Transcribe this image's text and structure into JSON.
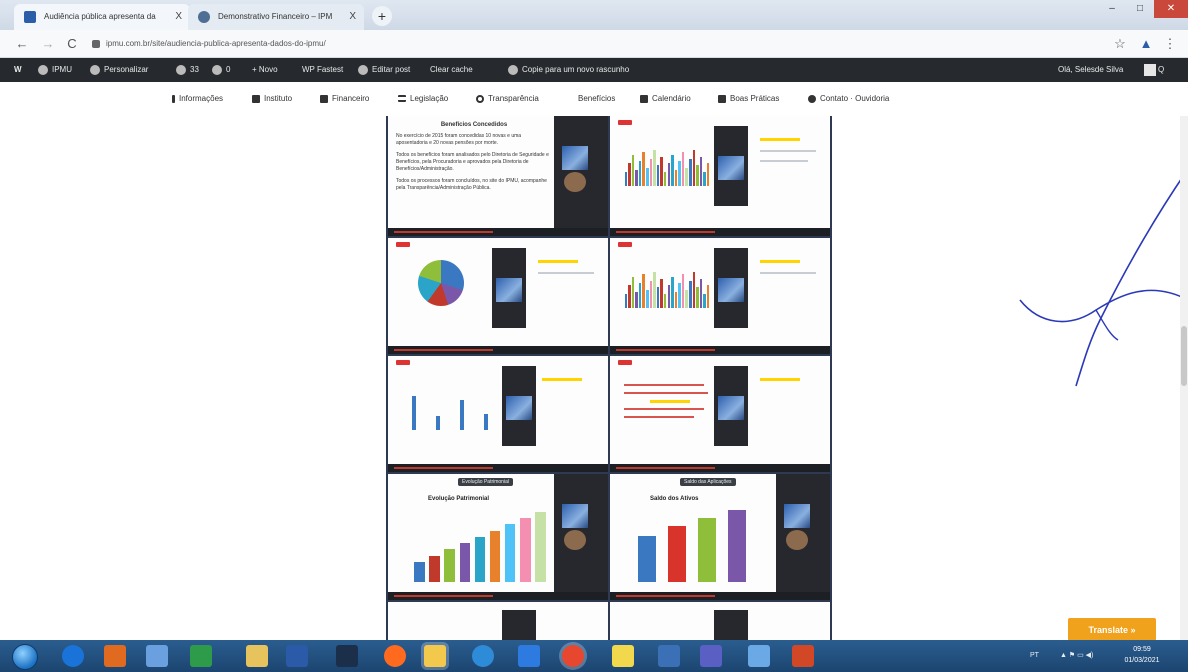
{
  "browser": {
    "tabs": [
      {
        "label": "Audiência pública apresenta da",
        "close": "X"
      },
      {
        "label": "Demonstrativo Financeiro – IPM",
        "close": "X"
      }
    ],
    "new_tab": "+",
    "window_controls": {
      "minimize": "–",
      "maximize": "□",
      "close": "✕"
    },
    "back": "←",
    "forward": "→",
    "reload": "C",
    "url": "ipmu.com.br/site/audiencia-publica-apresenta-dados-do-ipmu/",
    "star": "☆",
    "menu": "⋮"
  },
  "wp_admin_bar": {
    "wp_logo": "W",
    "site": "IPMU",
    "customize": "Personalizar",
    "updates": "33",
    "comments": "0",
    "new": "+ Novo",
    "wp_fastest": "WP Fastest",
    "edit_post": "Editar post",
    "clear_cache": "Clear cache",
    "copy_draft": "Copie para um novo rascunho",
    "greeting": "Olá, Selesde Silva",
    "search": "Q"
  },
  "site_nav": {
    "items": [
      "Informações",
      "Instituto",
      "Financeiro",
      "Legislação",
      "Transparência",
      "Benefícios",
      "Calendário",
      "Boas Práticas",
      "Contato · Ouvidoria"
    ]
  },
  "content": {
    "slide1": {
      "heading": "Benefícios Concedidos",
      "para1": "No exercício de 2015 foram concedidas 10 novas e uma aposentadoria e 20 novas pensões por morte.",
      "para2": "Todos os benefícios foram analisados pelo Diretoria de Seguridade e Benefícios, pela Procuradoria e aprovados pela Diretoria de Benefícios/Administração.",
      "para3": "Todos os processos foram concluídos, no site do IPMU, acompanhe pela Transparência/Administração Pública."
    },
    "labels": {
      "evolucao": "Evolução Patrimonial",
      "saldo": "Saldo dos Ativos",
      "banner1": "Evolução Patrimonial",
      "banner2": "Saldo das Aplicações"
    },
    "bar_colors": [
      "#3a78c2",
      "#c0392b",
      "#8fbf3a",
      "#7a57a8",
      "#2aa5c9",
      "#e8812c",
      "#4fc3f7",
      "#f48fb1",
      "#c5e1a5"
    ],
    "translate": "Translate »"
  },
  "taskbar": {
    "tray": "PT",
    "time": "09:59",
    "date": "01/03/2021"
  }
}
